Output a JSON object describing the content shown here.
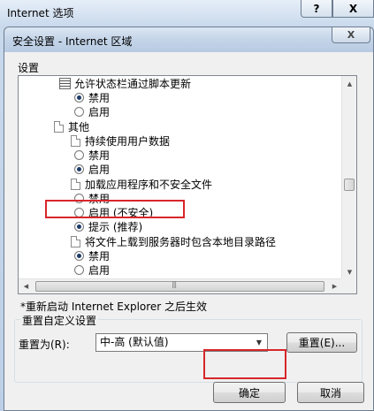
{
  "outer_window": {
    "title": "Internet 选项",
    "help_label": "?",
    "close_label": "X"
  },
  "dialog": {
    "title": "安全设置 - Internet 区域",
    "close_label": "X",
    "group_label": "设置",
    "settings_list": {
      "items": [
        {
          "kind": "script",
          "text": "允许状态栏通过脚本更新"
        },
        {
          "kind": "radio",
          "text": "禁用",
          "checked": true
        },
        {
          "kind": "radio",
          "text": "启用",
          "checked": false
        },
        {
          "kind": "doc",
          "text": "其他"
        },
        {
          "kind": "doc",
          "text": "持续使用用户数据"
        },
        {
          "kind": "radio",
          "text": "禁用",
          "checked": false
        },
        {
          "kind": "radio",
          "text": "启用",
          "checked": true
        },
        {
          "kind": "doc",
          "text": "加载应用程序和不安全文件"
        },
        {
          "kind": "radio",
          "text": "禁用",
          "checked": false
        },
        {
          "kind": "radio",
          "text": "启用 (不安全)",
          "checked": false
        },
        {
          "kind": "radio",
          "text": "提示 (推荐)",
          "checked": true
        },
        {
          "kind": "doc",
          "text": "将文件上载到服务器时包含本地目录路径"
        },
        {
          "kind": "radio",
          "text": "禁用",
          "checked": true
        },
        {
          "kind": "radio",
          "text": "启用",
          "checked": false
        }
      ]
    },
    "note": "*重新启动 Internet Explorer 之后生效",
    "reset_group": {
      "label": "重置自定义设置",
      "reset_to_label": "重置为(R):",
      "selected_level": "中-高 (默认值)",
      "reset_button": "重置(E)..."
    },
    "ok_button": "确定",
    "cancel_button": "取消"
  }
}
